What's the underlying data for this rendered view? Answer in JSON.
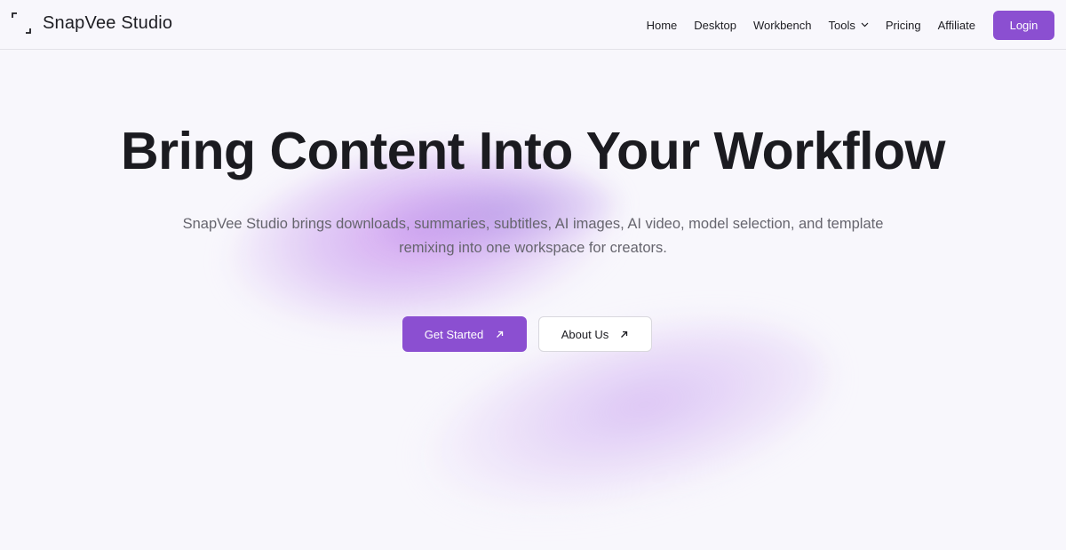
{
  "brand": {
    "name": "SnapVee Studio",
    "logo_icon": "corner-brackets-icon"
  },
  "nav": {
    "items": [
      {
        "label": "Home"
      },
      {
        "label": "Desktop"
      },
      {
        "label": "Workbench"
      },
      {
        "label": "Tools",
        "icon": "chevron-down-icon"
      },
      {
        "label": "Pricing"
      },
      {
        "label": "Affiliate"
      }
    ],
    "login_label": "Login"
  },
  "hero": {
    "title": "Bring Content Into Your Workflow",
    "subtitle": "SnapVee Studio brings downloads, summaries, subtitles, AI images, AI video, model selection, and template remixing into one workspace for creators.",
    "primary_cta": {
      "label": "Get Started",
      "icon": "arrow-up-right-icon"
    },
    "secondary_cta": {
      "label": "About Us",
      "icon": "arrow-up-right-icon"
    }
  },
  "colors": {
    "accent": "#8b4fd1",
    "background": "#f8f7fc",
    "text": "#1b1b20",
    "muted_text": "#66656e"
  }
}
